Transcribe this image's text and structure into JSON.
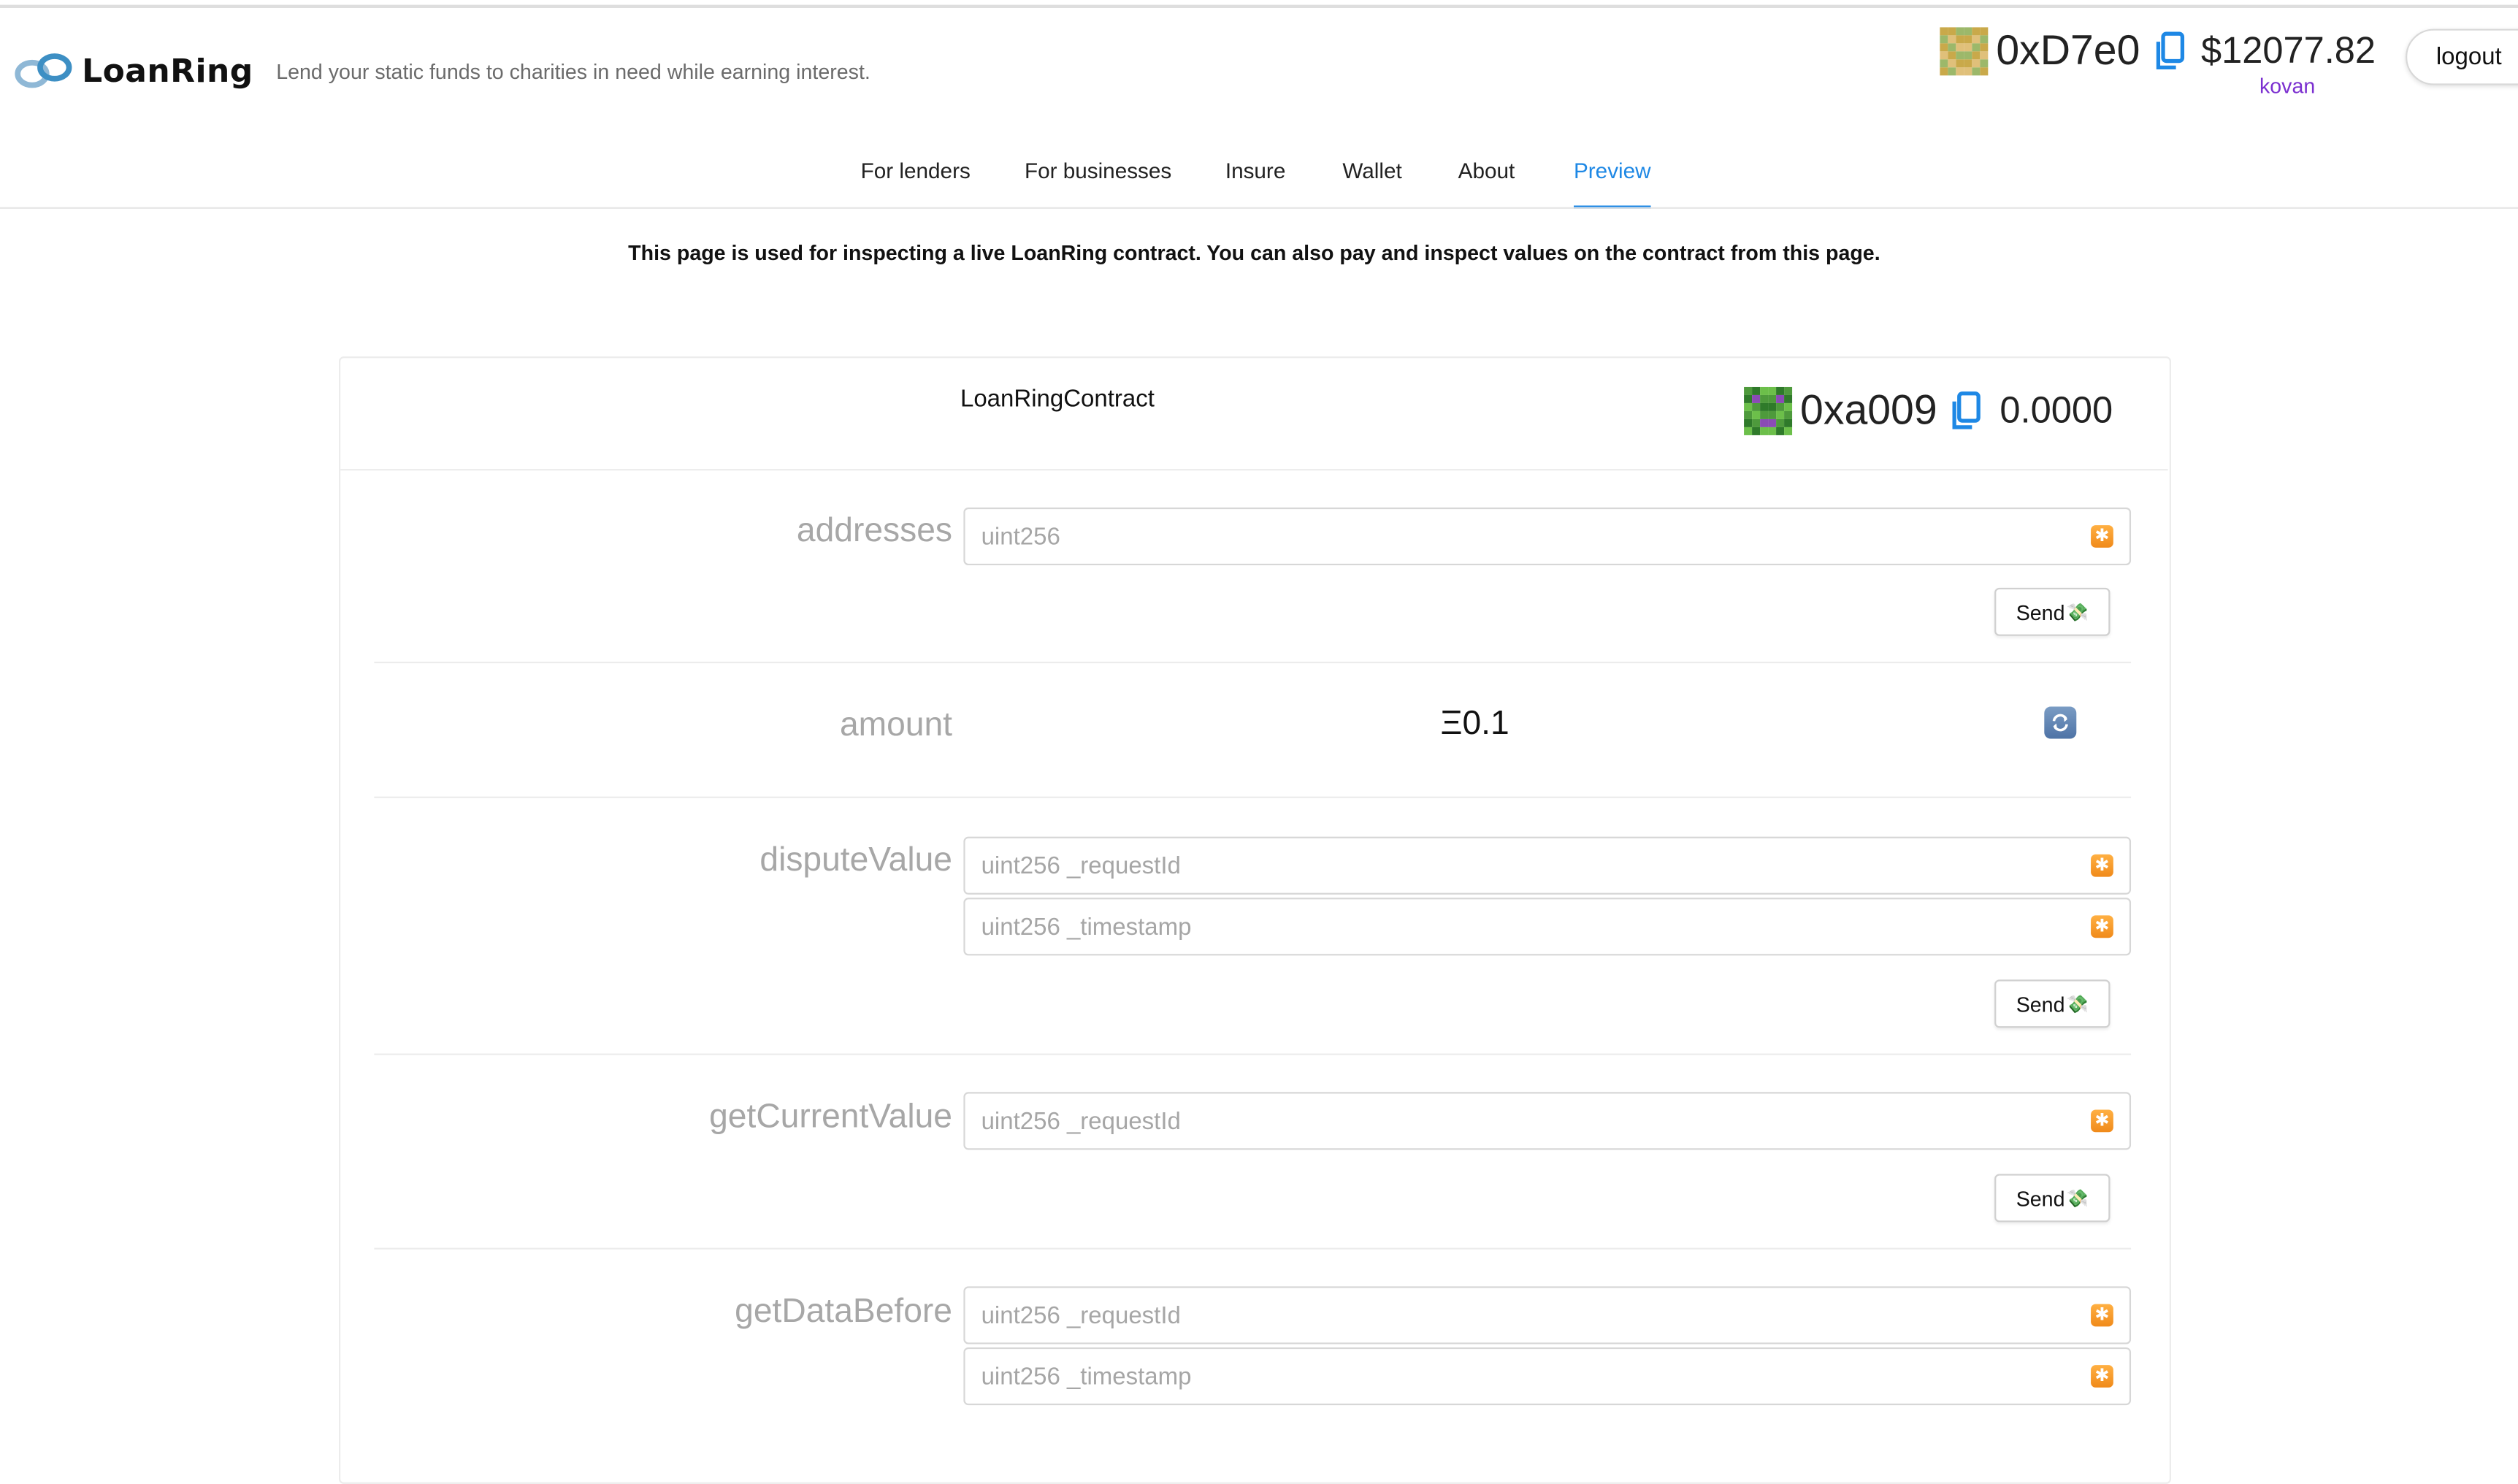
{
  "header": {
    "brand": "LoanRing",
    "tagline": "Lend your static funds to charities in need while earning interest.",
    "account_address": "0xD7e0",
    "account_balance": "$12077.82",
    "network": "kovan",
    "logout_label": "logout"
  },
  "nav": {
    "items": [
      {
        "label": "For lenders"
      },
      {
        "label": "For businesses"
      },
      {
        "label": "Insure"
      },
      {
        "label": "Wallet"
      },
      {
        "label": "About"
      },
      {
        "label": "Preview"
      }
    ],
    "active": "Preview"
  },
  "notice": "This page is used for inspecting a live LoanRing contract. You can also pay and inspect values on the contract from this page.",
  "contract": {
    "title": "LoanRingContract",
    "address": "0xa009",
    "balance": "0.0000"
  },
  "functions": [
    {
      "name": "addresses",
      "inputs": [
        {
          "placeholder": "uint256"
        }
      ],
      "send_label": "Send"
    },
    {
      "name": "amount",
      "value": "Ξ0.1"
    },
    {
      "name": "disputeValue",
      "inputs": [
        {
          "placeholder": "uint256 _requestId"
        },
        {
          "placeholder": "uint256 _timestamp"
        }
      ],
      "send_label": "Send"
    },
    {
      "name": "getCurrentValue",
      "inputs": [
        {
          "placeholder": "uint256 _requestId"
        }
      ],
      "send_label": "Send"
    },
    {
      "name": "getDataBefore",
      "inputs": [
        {
          "placeholder": "uint256 _requestId"
        },
        {
          "placeholder": "uint256 _timestamp"
        }
      ]
    }
  ],
  "colors": {
    "accent": "#1e88e5",
    "network": "#7b2fd0",
    "label_gray": "#a7a7a7"
  },
  "icons": {
    "logo": "infinity-ring-icon",
    "copy": "copy-icon",
    "input_action": "star-icon",
    "send": "money-icon",
    "refresh": "refresh-icon"
  }
}
